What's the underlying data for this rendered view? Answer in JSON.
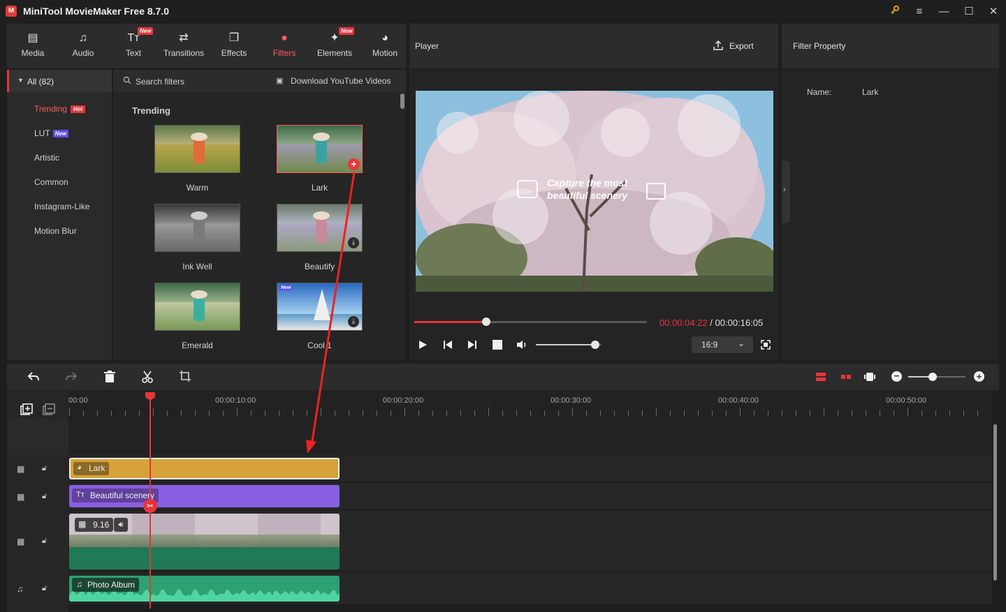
{
  "app": {
    "title": "MiniTool MovieMaker Free 8.7.0",
    "logo": "M"
  },
  "window_controls": {
    "key_icon": "key-icon",
    "menu_icon": "menu-icon",
    "minimize": "—",
    "maximize": "☐",
    "close": "✕"
  },
  "toolbar": {
    "tabs": [
      {
        "label": "Media",
        "icon": "folder-icon",
        "glyph": "▤",
        "badge": ""
      },
      {
        "label": "Audio",
        "icon": "music-icon",
        "glyph": "♫",
        "badge": ""
      },
      {
        "label": "Text",
        "icon": "text-icon",
        "glyph": "Tт",
        "badge": "New"
      },
      {
        "label": "Transitions",
        "icon": "transitions-icon",
        "glyph": "⇄",
        "badge": ""
      },
      {
        "label": "Effects",
        "icon": "effects-icon",
        "glyph": "❐",
        "badge": ""
      },
      {
        "label": "Filters",
        "icon": "filters-icon",
        "glyph": "●",
        "badge": ""
      },
      {
        "label": "Elements",
        "icon": "elements-icon",
        "glyph": "✦",
        "badge": "New"
      },
      {
        "label": "Motion",
        "icon": "motion-icon",
        "glyph": "◕",
        "badge": ""
      }
    ],
    "active": "Filters",
    "accent": "#ff5c5c"
  },
  "sidebar": {
    "all_label": "All (82)",
    "categories": [
      {
        "label": "Trending",
        "badge": "Hot"
      },
      {
        "label": "LUT",
        "badge": "New"
      },
      {
        "label": "Artistic",
        "badge": ""
      },
      {
        "label": "Common",
        "badge": ""
      },
      {
        "label": "Instagram-Like",
        "badge": ""
      },
      {
        "label": "Motion Blur",
        "badge": ""
      }
    ]
  },
  "filters_panel": {
    "search_placeholder": "Search filters",
    "download_label": "Download YouTube Videos",
    "section_title": "Trending",
    "items": [
      {
        "label": "Warm"
      },
      {
        "label": "Lark"
      },
      {
        "label": "Ink Well"
      },
      {
        "label": "Beautify"
      },
      {
        "label": "Emerald"
      },
      {
        "label": "Cool 1",
        "badge": "New"
      }
    ]
  },
  "player": {
    "title": "Player",
    "export_label": "Export",
    "overlay_text_line1": "Capture the most",
    "overlay_text_line2": "beautiful scenery",
    "current_time": "00:00:04:22",
    "separator": " / ",
    "total_time": "00:00:16:05",
    "aspect_ratio": "16:9",
    "progress": 0.31,
    "volume": 0.9
  },
  "filter_property": {
    "title": "Filter Property",
    "name_label": "Name:",
    "name_value": "Lark"
  },
  "timeline": {
    "ruler_labels": [
      "00:00",
      "00:00:10:00",
      "00:00:20:00",
      "00:00:30:00",
      "00:00:40:00",
      "00:00:50:00"
    ],
    "clips": {
      "filter_clip": "Lark",
      "text_clip": "Beautiful scenery",
      "video_clip_duration": "9.16",
      "audio_clip": "Photo Album"
    },
    "colors": {
      "filter": "#d7a23a",
      "text": "#8a5ee0",
      "video": "#1f7a55",
      "audio": "#2ea173",
      "playhead": "#e8343a"
    }
  }
}
